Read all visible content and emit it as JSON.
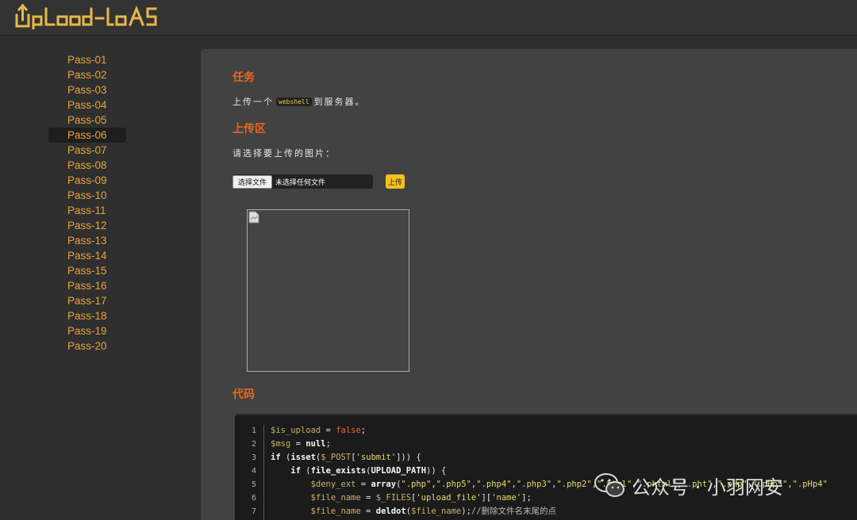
{
  "app": {
    "logo_text": "Upload-labs"
  },
  "sidebar": {
    "items": [
      "Pass-01",
      "Pass-02",
      "Pass-03",
      "Pass-04",
      "Pass-05",
      "Pass-06",
      "Pass-07",
      "Pass-08",
      "Pass-09",
      "Pass-10",
      "Pass-11",
      "Pass-12",
      "Pass-13",
      "Pass-14",
      "Pass-15",
      "Pass-16",
      "Pass-17",
      "Pass-18",
      "Pass-19",
      "Pass-20"
    ],
    "active_index": 5
  },
  "task": {
    "heading": "任务",
    "text_before": "上传一个",
    "badge": "webshell",
    "text_after": "到服务器。"
  },
  "upload": {
    "heading": "上传区",
    "prompt": "请选择要上传的图片：",
    "choose_button": "选择文件",
    "file_status": "未选择任何文件",
    "submit_button": "上传"
  },
  "code": {
    "heading": "代码",
    "line_numbers": [
      "1",
      "2",
      "3",
      "4",
      "5",
      "6",
      "7"
    ],
    "lines": [
      [
        [
          "v",
          "$is_upload"
        ],
        [
          "p",
          " = "
        ],
        [
          "r",
          "false"
        ],
        [
          "p",
          ";"
        ]
      ],
      [
        [
          "v",
          "$msg"
        ],
        [
          "p",
          " = "
        ],
        [
          "k",
          "null"
        ],
        [
          "p",
          ";"
        ]
      ],
      [
        [
          "k",
          "if"
        ],
        [
          "p",
          " ("
        ],
        [
          "k",
          "isset"
        ],
        [
          "p",
          "("
        ],
        [
          "v",
          "$_POST"
        ],
        [
          "p",
          "["
        ],
        [
          "s",
          "'submit'"
        ],
        [
          "p",
          "])) {"
        ]
      ],
      [
        [
          "p",
          "    "
        ],
        [
          "k",
          "if"
        ],
        [
          "p",
          " ("
        ],
        [
          "k",
          "file_exists"
        ],
        [
          "p",
          "("
        ],
        [
          "k",
          "UPLOAD_PATH"
        ],
        [
          "p",
          ")) {"
        ]
      ],
      [
        [
          "p",
          "        "
        ],
        [
          "v",
          "$deny_ext"
        ],
        [
          "p",
          " = "
        ],
        [
          "k",
          "array"
        ],
        [
          "p",
          "("
        ],
        [
          "s",
          "\".php\""
        ],
        [
          "p",
          ","
        ],
        [
          "s",
          "\".php5\""
        ],
        [
          "p",
          ","
        ],
        [
          "s",
          "\".php4\""
        ],
        [
          "p",
          ","
        ],
        [
          "s",
          "\".php3\""
        ],
        [
          "p",
          ","
        ],
        [
          "s",
          "\".php2\""
        ],
        [
          "p",
          ","
        ],
        [
          "s",
          "\".html\""
        ],
        [
          "p",
          ","
        ],
        [
          "s",
          "\".phtml\""
        ],
        [
          "p",
          ","
        ],
        [
          "s",
          "\".pht\""
        ],
        [
          "p",
          ","
        ],
        [
          "s",
          "\".pHp\""
        ],
        [
          "p",
          ","
        ],
        [
          "s",
          "\".pHp5\""
        ],
        [
          "p",
          ","
        ],
        [
          "s",
          "\".pHp4\""
        ]
      ],
      [
        [
          "p",
          "        "
        ],
        [
          "v",
          "$file_name"
        ],
        [
          "p",
          " = "
        ],
        [
          "v",
          "$_FILES"
        ],
        [
          "p",
          "["
        ],
        [
          "s",
          "'upload_file'"
        ],
        [
          "p",
          "]["
        ],
        [
          "s",
          "'name'"
        ],
        [
          "p",
          "];"
        ]
      ],
      [
        [
          "p",
          "        "
        ],
        [
          "v",
          "$file_name"
        ],
        [
          "p",
          " = "
        ],
        [
          "k",
          "deldot"
        ],
        [
          "p",
          "("
        ],
        [
          "v",
          "$file_name"
        ],
        [
          "p",
          ");"
        ],
        [
          "c",
          "//删除文件名末尾的点"
        ]
      ]
    ]
  },
  "watermark": {
    "text": "公众号 · 小羽网安"
  }
}
